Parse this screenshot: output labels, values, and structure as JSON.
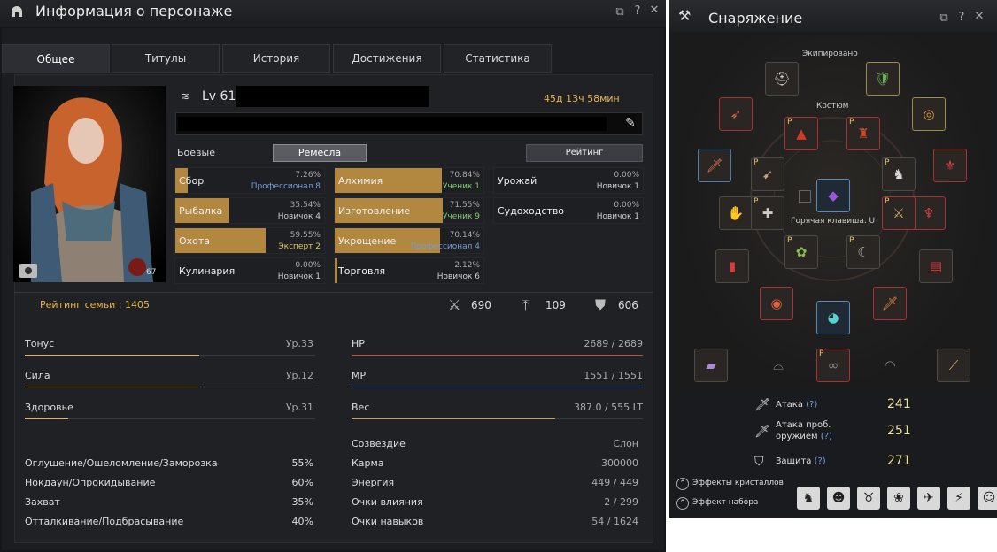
{
  "left_window": {
    "title": "Информация о персонаже",
    "tabs": [
      "Общее",
      "Титулы",
      "История",
      "Достижения",
      "Статистика"
    ],
    "level": "Lv 61",
    "playtime": "45д 13ч 58мин",
    "portrait_badge": "67",
    "buttons": {
      "combat": "Боевые характер...",
      "crafts": "Ремесла",
      "rating": "Рейтинг"
    },
    "skills": [
      {
        "name": "Сбор",
        "pct": "7.26%",
        "rank": "Профессионал 8",
        "fill": 0.08,
        "rank_color": "#6f9fd8"
      },
      {
        "name": "Рыбалка",
        "pct": "35.54%",
        "rank": "Новичок 4",
        "fill": 0.36,
        "rank_color": "#cfcfcf"
      },
      {
        "name": "Охота",
        "pct": "59.55%",
        "rank": "Эксперт 2",
        "fill": 0.6,
        "rank_color": "#e6c55a"
      },
      {
        "name": "Кулинария",
        "pct": "0.00%",
        "rank": "Новичок 1",
        "fill": 0.0,
        "rank_color": "#cfcfcf"
      },
      {
        "name": "Алхимия",
        "pct": "70.84%",
        "rank": "Ученик 1",
        "fill": 0.71,
        "rank_color": "#7fcf6a"
      },
      {
        "name": "Изготовление",
        "pct": "71.55%",
        "rank": "Ученик 9",
        "fill": 0.72,
        "rank_color": "#7fcf6a"
      },
      {
        "name": "Укрощение",
        "pct": "70.14%",
        "rank": "Профессионал 4",
        "fill": 0.7,
        "rank_color": "#6f9fd8"
      },
      {
        "name": "Торговля",
        "pct": "2.12%",
        "rank": "Новичок 6",
        "fill": 0.02,
        "rank_color": "#cfcfcf"
      },
      {
        "name": "Урожай",
        "pct": "0.00%",
        "rank": "Новичок 1",
        "fill": 0.0,
        "rank_color": "#cfcfcf"
      },
      {
        "name": "Судоходство",
        "pct": "0.00%",
        "rank": "Новичок 1",
        "fill": 0.0,
        "rank_color": "#cfcfcf"
      }
    ],
    "family_rating_label": "Рейтинг семьи : 1405",
    "combat_stats": [
      {
        "icon": "crossed-swords-icon",
        "glyph": "⚔",
        "value": "690"
      },
      {
        "icon": "awakening-icon",
        "glyph": "⤒",
        "value": "109"
      },
      {
        "icon": "defense-icon",
        "glyph": "⛊",
        "value": "606"
      }
    ],
    "attributes": [
      {
        "label": "Тонус",
        "value": "Ур.33",
        "fill": 0.6
      },
      {
        "label": "Сила",
        "value": "Ур.12",
        "fill": 0.6
      },
      {
        "label": "Здоровье",
        "value": "Ур.31",
        "fill": 0.15
      }
    ],
    "vitals": [
      {
        "label": "HP",
        "value": "2689 / 2689",
        "fill": 1.0,
        "color": "#c0503c"
      },
      {
        "label": "MP",
        "value": "1551 / 1551",
        "fill": 1.0,
        "color": "#4d7fd0"
      },
      {
        "label": "Вес",
        "value": "387.0 / 555 LT",
        "fill": 0.7,
        "color": "#c8a24a"
      }
    ],
    "resistances": [
      {
        "label": "Оглушение/Ошеломление/Заморозка",
        "value": "55%"
      },
      {
        "label": "Нокдаун/Опрокидывание",
        "value": "60%"
      },
      {
        "label": "Захват",
        "value": "35%"
      },
      {
        "label": "Отталкивание/Подбрасывание",
        "value": "40%"
      }
    ],
    "misc": [
      {
        "label": "Созвездие",
        "value": "Слон"
      },
      {
        "label": "Карма",
        "value": "300000"
      },
      {
        "label": "Энергия",
        "value": "449 / 449"
      },
      {
        "label": "Очки влияния",
        "value": "2 / 299"
      },
      {
        "label": "Очки навыков",
        "value": "54 / 1624"
      }
    ]
  },
  "right_window": {
    "title": "Снаряжение",
    "equipped_label": "Экипировано",
    "costume_label": "Костюм",
    "hotkey_label": "Горячая клавиша. U",
    "stats": [
      {
        "icon": "sword-icon",
        "glyph": "🗡",
        "label1": "Атака",
        "label2": "",
        "help": "(?)",
        "value": "241"
      },
      {
        "icon": "awakening-sword-icon",
        "glyph": "🗡",
        "label1": "Атака проб.",
        "label2": "оружием",
        "help": "(?)",
        "value": "251"
      },
      {
        "icon": "shield-icon",
        "glyph": "⛉",
        "label1": "Защита",
        "help": "(?)",
        "label2": "",
        "value": "271"
      }
    ],
    "links": [
      "Эффекты кристаллов",
      "Эффект набора"
    ],
    "pet_buttons": [
      "horse-icon",
      "mask-icon",
      "mount-icon",
      "paw-icon",
      "dragon-icon",
      "wyvern-icon",
      "camel-icon"
    ]
  },
  "colors": {
    "accent": "#e7b649",
    "window_bg": "#16171a",
    "panel_bg": "#202125"
  }
}
